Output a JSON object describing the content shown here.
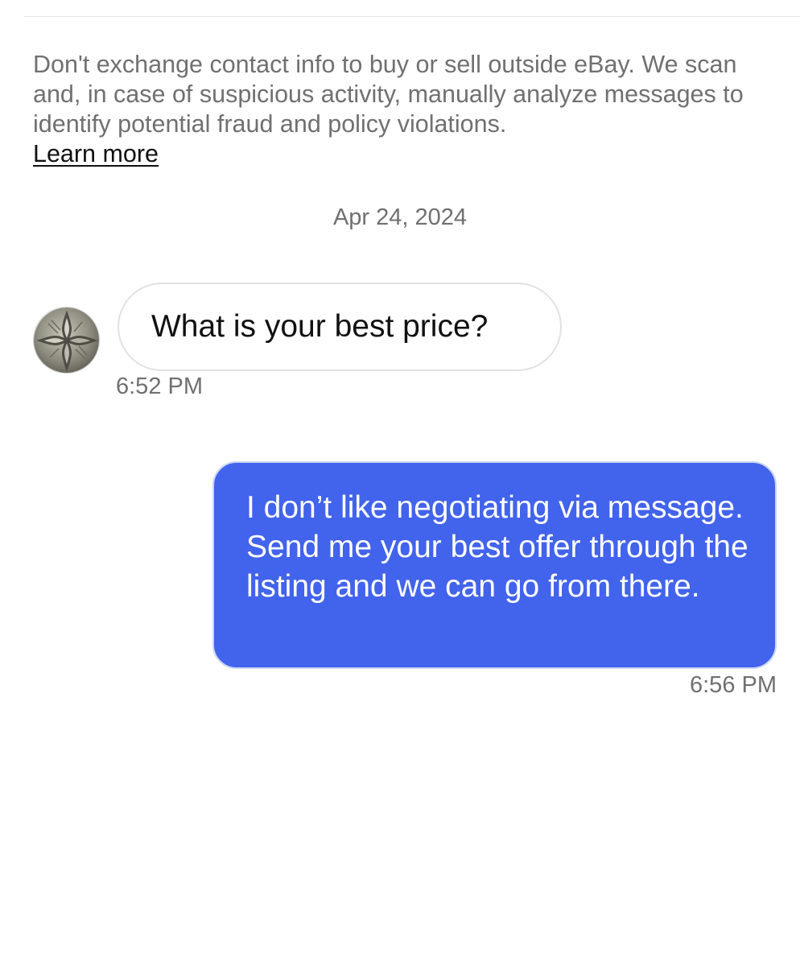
{
  "notice": {
    "text": "Don't exchange contact info to buy or sell outside eBay. We scan and, in case of suspicious activity, manually analyze messages to identify potential fraud and policy violations.",
    "learn_more": "Learn more"
  },
  "date_separator": "Apr 24, 2024",
  "messages": [
    {
      "direction": "incoming",
      "text": "What is your best price?",
      "time": "6:52 PM"
    },
    {
      "direction": "outgoing",
      "text": "I don’t like negotiating via message. Send me your best offer through the listing and we can go from there.",
      "time": "6:56 PM"
    }
  ],
  "colors": {
    "outgoing_bubble": "#4263eb",
    "muted_text": "#707070",
    "primary_text": "#111111"
  },
  "icons": {
    "avatar": "coin-cross-avatar"
  }
}
